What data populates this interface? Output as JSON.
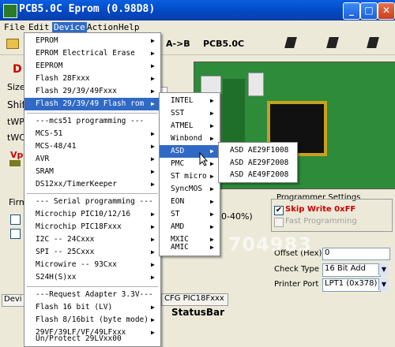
{
  "window": {
    "title": "PCB5.0C Eprom  (0.98D8)",
    "min": "_",
    "max": "□",
    "close": "✕"
  },
  "menubar": [
    "File",
    "Edit",
    "Device",
    "Action",
    "Help"
  ],
  "toolbar": {
    "ab_label": "A->B",
    "name_label": "PCB5.0C",
    "open_icon": "folder-open-icon",
    "chip_icon": "chip-icon"
  },
  "left_panel": {
    "d_label": "D",
    "size_label": "Size",
    "shift_label": "Shif",
    "twp_label": "tWP",
    "twc_label": "tWC",
    "vp_label": "Vp",
    "firm_label": "Firm",
    "tab_label": "Devi"
  },
  "mid_panel": {
    "percent_label": "0-40%)",
    "cfg_tab": "CFG PIC18Fxxx"
  },
  "programmer_settings": {
    "legend": "Programmer Settings",
    "skip_write": {
      "label": "Skip Write 0xFF",
      "checked": true
    },
    "fast_programming": {
      "label": "Fast Programming",
      "checked": false
    },
    "offset": {
      "label": "Offset (Hex)",
      "value": "0"
    },
    "check_type": {
      "label": "Check Type",
      "value": "16 Bit Add"
    },
    "printer_port": {
      "label": "Printer Port",
      "value": "LPT1 (0x378)"
    }
  },
  "statusbar": {
    "text": "StatusBar"
  },
  "watermark": "Mic 704983",
  "device_menu": {
    "items": [
      {
        "label": "EPROM",
        "arrow": true
      },
      {
        "label": "EPROM  Electrical Erase",
        "arrow": true
      },
      {
        "label": "EEPROM",
        "arrow": true
      },
      {
        "label": "Flash 28Fxxx",
        "arrow": true
      },
      {
        "label": "Flash 29/39/49Fxxx",
        "arrow": true
      },
      {
        "label": "Flash 29/39/49 Flash rom",
        "arrow": true,
        "highlighted": true
      },
      {
        "label": "---mcs51 programming ---",
        "arrow": false,
        "separator_before": true
      },
      {
        "label": "MCS-51",
        "arrow": true
      },
      {
        "label": "MCS-48/41",
        "arrow": true
      },
      {
        "label": "AVR",
        "arrow": true
      },
      {
        "label": "SRAM",
        "arrow": true
      },
      {
        "label": "DS12xx/TimerKeeper",
        "arrow": true
      },
      {
        "label": "--- Serial programming ---",
        "arrow": false,
        "separator_before": true
      },
      {
        "label": "Microchip PIC10/12/16",
        "arrow": true
      },
      {
        "label": "Microchip PIC18Fxxx",
        "arrow": true
      },
      {
        "label": "I2C -- 24Cxxx",
        "arrow": true
      },
      {
        "label": "SPI -- 25Cxxx",
        "arrow": true
      },
      {
        "label": "Microwire -- 93Cxx",
        "arrow": true
      },
      {
        "label": "S24H(S)xx",
        "arrow": true
      },
      {
        "label": "---Request Adapter 3.3V---",
        "arrow": false,
        "separator_before": true
      },
      {
        "label": "Flash 16 bit (LV)",
        "arrow": true
      },
      {
        "label": "Flash 8/16bit (byte mode)",
        "arrow": true
      },
      {
        "label": "29VF/39LF/VF/49LFxxx",
        "arrow": true
      },
      {
        "label": "Un/Protect 29LVxx00",
        "arrow": false
      }
    ]
  },
  "manufacturer_menu": {
    "items": [
      {
        "label": "INTEL",
        "arrow": true
      },
      {
        "label": "SST",
        "arrow": true
      },
      {
        "label": "ATMEL",
        "arrow": true
      },
      {
        "label": "Winbond",
        "arrow": true
      },
      {
        "label": "ASD",
        "arrow": true,
        "highlighted": true
      },
      {
        "label": "PMC",
        "arrow": true
      },
      {
        "label": "ST micro",
        "arrow": true
      },
      {
        "label": "SyncMOS",
        "arrow": true
      },
      {
        "label": "EON",
        "arrow": true
      },
      {
        "label": "ST",
        "arrow": true
      },
      {
        "label": "AMD",
        "arrow": true
      },
      {
        "label": "MXIC",
        "arrow": true
      },
      {
        "label": "AMIC",
        "arrow": true
      }
    ]
  },
  "chip_menu": {
    "items": [
      {
        "label": "ASD  AE29F1008"
      },
      {
        "label": "ASD  AE29F2008"
      },
      {
        "label": "ASD  AE49F2008"
      }
    ]
  },
  "colors": {
    "title_bar": "#0347c2",
    "highlight": "#316ac5",
    "board_green": "#2e8b3a",
    "red_label": "#cc0000"
  }
}
